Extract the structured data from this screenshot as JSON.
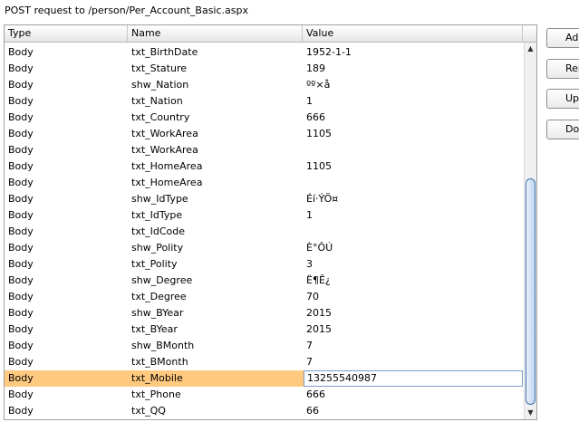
{
  "request_title": "POST request to /person/Per_Account_Basic.aspx",
  "columns": {
    "type": "Type",
    "name": "Name",
    "value": "Value"
  },
  "rows": [
    {
      "type": "Body",
      "name": "txt_BirthDate",
      "value": "1952-1-1"
    },
    {
      "type": "Body",
      "name": "txt_Stature",
      "value": "189"
    },
    {
      "type": "Body",
      "name": "shw_Nation",
      "value": "ºº×å"
    },
    {
      "type": "Body",
      "name": "txt_Nation",
      "value": "1"
    },
    {
      "type": "Body",
      "name": "txt_Country",
      "value": "666"
    },
    {
      "type": "Body",
      "name": "txt_WorkArea",
      "value": "1105"
    },
    {
      "type": "Body",
      "name": "txt_WorkArea",
      "value": ""
    },
    {
      "type": "Body",
      "name": "txt_HomeArea",
      "value": "1105"
    },
    {
      "type": "Body",
      "name": "txt_HomeArea",
      "value": ""
    },
    {
      "type": "Body",
      "name": "shw_IdType",
      "value": "Éí·ÝÖ¤"
    },
    {
      "type": "Body",
      "name": "txt_IdType",
      "value": "1"
    },
    {
      "type": "Body",
      "name": "txt_IdCode",
      "value": ""
    },
    {
      "type": "Body",
      "name": "shw_Polity",
      "value": "È°ÔÚ"
    },
    {
      "type": "Body",
      "name": "txt_Polity",
      "value": "3"
    },
    {
      "type": "Body",
      "name": "shw_Degree",
      "value": "Ë¶Ê¿"
    },
    {
      "type": "Body",
      "name": "txt_Degree",
      "value": "70"
    },
    {
      "type": "Body",
      "name": "shw_BYear",
      "value": "2015"
    },
    {
      "type": "Body",
      "name": "txt_BYear",
      "value": "2015"
    },
    {
      "type": "Body",
      "name": "shw_BMonth",
      "value": "7"
    },
    {
      "type": "Body",
      "name": "txt_BMonth",
      "value": "7"
    },
    {
      "type": "Body",
      "name": "txt_Mobile",
      "value": "13255540987",
      "selected": true
    },
    {
      "type": "Body",
      "name": "txt_Phone",
      "value": "666"
    },
    {
      "type": "Body",
      "name": "txt_QQ",
      "value": "66"
    }
  ],
  "buttons": {
    "add": "Ad",
    "remove": "Remo",
    "up": "Up",
    "down": "Dow"
  },
  "icons": {
    "scroll_up": "triangle-up-icon",
    "scroll_down": "triangle-down-icon"
  },
  "colors": {
    "selection": "#ffc97f",
    "scroll_thumb_border": "#3a6fb0"
  }
}
